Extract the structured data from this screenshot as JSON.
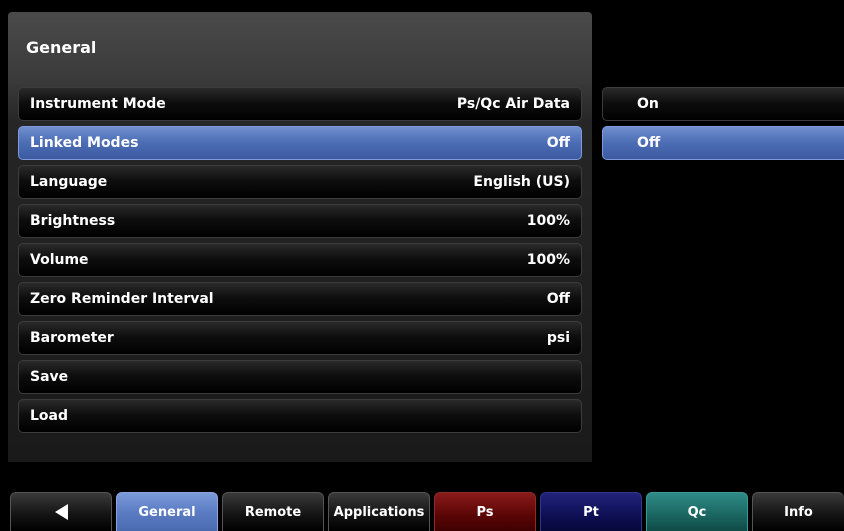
{
  "panel": {
    "title": "General"
  },
  "settings": [
    {
      "label": "Instrument Mode",
      "value": "Ps/Qc Air Data"
    },
    {
      "label": "Linked Modes",
      "value": "Off"
    },
    {
      "label": "Language",
      "value": "English (US)"
    },
    {
      "label": "Brightness",
      "value": "100%"
    },
    {
      "label": "Volume",
      "value": "100%"
    },
    {
      "label": "Zero Reminder Interval",
      "value": "Off"
    },
    {
      "label": "Barometer",
      "value": "psi"
    },
    {
      "label": "Save",
      "value": ""
    },
    {
      "label": "Load",
      "value": ""
    }
  ],
  "selected_setting": "Linked Modes",
  "options": [
    {
      "label": "On"
    },
    {
      "label": "Off"
    }
  ],
  "selected_option": "Off",
  "tabs": [
    {
      "label": "",
      "icon": "back-arrow-icon"
    },
    {
      "label": "General"
    },
    {
      "label": "Remote"
    },
    {
      "label": "Applications"
    },
    {
      "label": "Ps"
    },
    {
      "label": "Pt"
    },
    {
      "label": "Qc"
    },
    {
      "label": "Info"
    }
  ],
  "active_tab": "General",
  "colors": {
    "selection": "#4c6cb4",
    "ps_tab": "#5a0505",
    "pt_tab": "#0e0f54",
    "qc_tab": "#1a6560"
  }
}
